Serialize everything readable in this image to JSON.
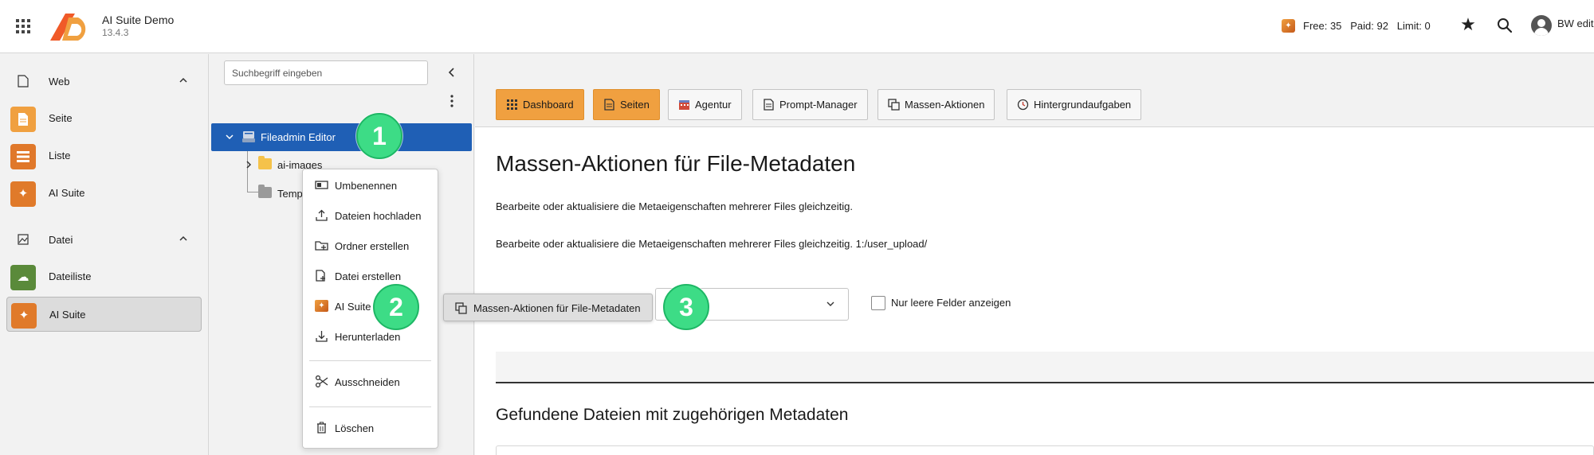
{
  "header": {
    "app_name": "AI Suite Demo",
    "app_version": "13.4.3",
    "quota": "Free: 35   Paid: 92   Limit: 0",
    "user_name": "BW edit"
  },
  "module_menu": {
    "groups": [
      {
        "label": "Web",
        "items": [
          {
            "label": "Seite",
            "color": "#f0a040"
          },
          {
            "label": "Liste",
            "color": "#e0782a"
          },
          {
            "label": "AI Suite",
            "color": "#e07a2a"
          }
        ]
      },
      {
        "label": "Datei",
        "items": [
          {
            "label": "Dateiliste",
            "color": "#5a8a3a"
          },
          {
            "label": "AI Suite",
            "color": "#e07a2a",
            "active": true
          }
        ]
      }
    ]
  },
  "tree": {
    "search_placeholder": "Suchbegriff eingeben",
    "root": "Fileadmin Editor",
    "children": [
      "ai-images",
      "Temp"
    ]
  },
  "toolbar": {
    "buttons": [
      {
        "label": "Dashboard",
        "icon": "grid-icon",
        "active": true
      },
      {
        "label": "Seiten",
        "icon": "page-icon",
        "active": true
      },
      {
        "label": "Agentur",
        "icon": "agency-icon",
        "active": false
      },
      {
        "label": "Prompt-Manager",
        "icon": "document-icon",
        "active": false
      },
      {
        "label": "Massen-Aktionen",
        "icon": "copy-icon",
        "active": false
      },
      {
        "label": "Hintergrundaufgaben",
        "icon": "clock-icon",
        "active": false
      }
    ]
  },
  "main": {
    "title": "Massen-Aktionen für File-Metadaten",
    "description_1": "Bearbeite oder aktualisiere die Metaeigenschaften mehrerer Files gleichzeitig.",
    "description_2": "Bearbeite oder aktualisiere die Metaeigenschaften mehrerer Files gleichzeitig. 1:/user_upload/",
    "checkbox_label": "Nur leere Felder anzeigen",
    "found_title": "Gefundene Dateien mit zugehörigen Metadaten"
  },
  "context_menu": {
    "items": [
      "Umbenennen",
      "Dateien hochladen",
      "Ordner erstellen",
      "Datei erstellen",
      "AI Suite",
      "Herunterladen",
      "Ausschneiden",
      "Löschen"
    ],
    "submenu_item": "Massen-Aktionen für File-Metadaten"
  },
  "steps": [
    "1",
    "2",
    "3"
  ],
  "colors": {
    "accent_orange": "#f0a040",
    "tree_selected": "#1f5fb5",
    "step_marker": "#3ddc86"
  }
}
